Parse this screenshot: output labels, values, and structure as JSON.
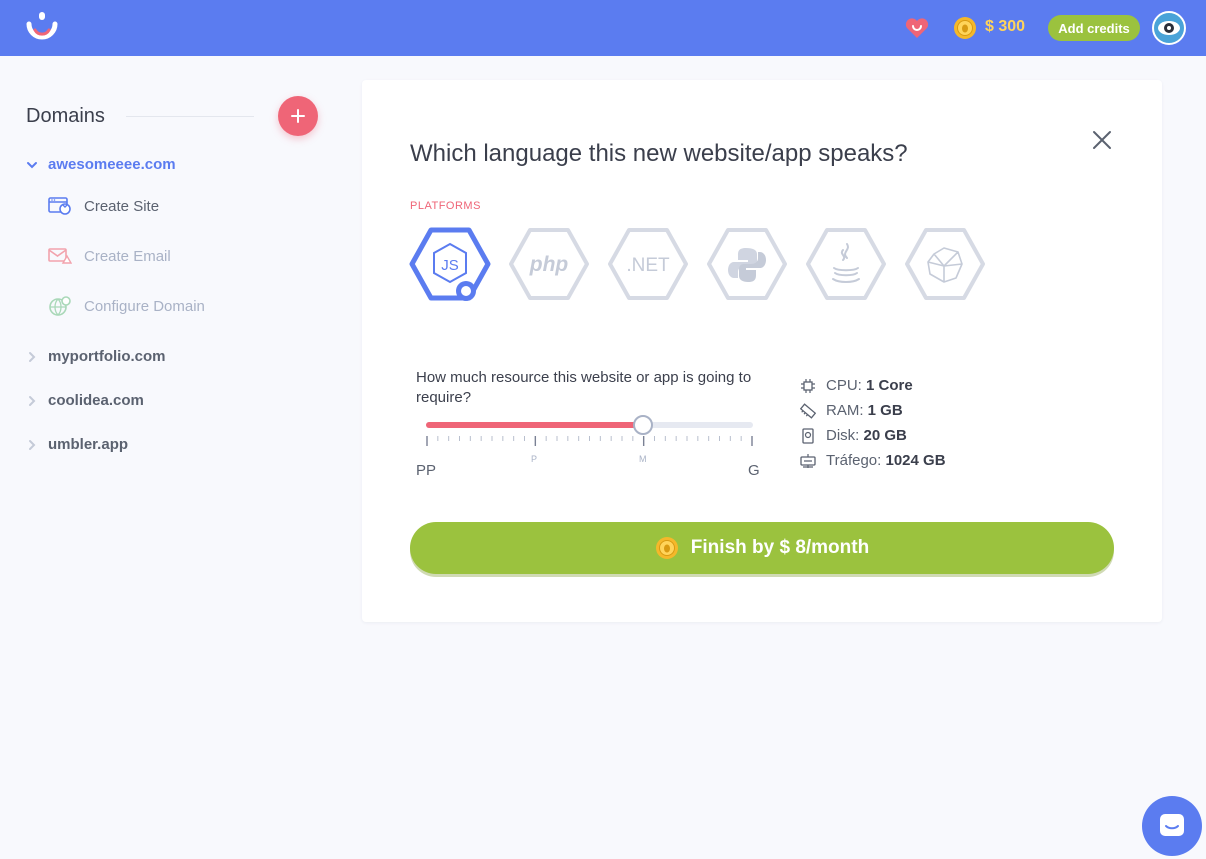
{
  "header": {
    "credits_amount": "$ 300",
    "add_credits_label": "Add credits"
  },
  "sidebar": {
    "title": "Domains",
    "domains": [
      {
        "label": "awesomeeee.com",
        "expanded": true
      },
      {
        "label": "myportfolio.com",
        "expanded": false
      },
      {
        "label": "coolidea.com",
        "expanded": false
      },
      {
        "label": "umbler.app",
        "expanded": false
      }
    ],
    "sub_items": [
      {
        "label": "Create Site",
        "icon": "browser-icon",
        "enabled": true
      },
      {
        "label": "Create Email",
        "icon": "envelope-icon",
        "enabled": false
      },
      {
        "label": "Configure Domain",
        "icon": "globe-icon",
        "enabled": false
      }
    ]
  },
  "modal": {
    "title": "Which language this new website/app speaks?",
    "platforms_label": "PLATFORMS",
    "platforms": [
      {
        "name": "nodejs",
        "icon": "nodejs-icon",
        "selected": true
      },
      {
        "name": "php",
        "label": "php",
        "icon": "php-icon",
        "selected": false
      },
      {
        "name": "dotnet",
        "label": ".NET",
        "icon": "dotnet-icon",
        "selected": false
      },
      {
        "name": "python",
        "icon": "python-icon",
        "selected": false
      },
      {
        "name": "java",
        "icon": "java-icon",
        "selected": false
      },
      {
        "name": "ruby",
        "icon": "ruby-icon",
        "selected": false
      }
    ],
    "resource": {
      "question": "How much resource this website or app is going to require?",
      "level_fraction": 0.665,
      "scale_labels": {
        "start": "PP",
        "small": "P",
        "medium": "M",
        "end": "G"
      }
    },
    "specs": [
      {
        "label": "CPU:",
        "value": "1 Core",
        "icon": "cpu-icon"
      },
      {
        "label": "RAM:",
        "value": "1 GB",
        "icon": "ram-icon"
      },
      {
        "label": "Disk:",
        "value": "20 GB",
        "icon": "disk-icon"
      },
      {
        "label": "Tráfego:",
        "value": "1024 GB",
        "icon": "traffic-icon"
      }
    ],
    "finish_label": "Finish by $ 8/month"
  },
  "colors": {
    "brand_blue": "#5b7cf0",
    "accent_red": "#ef6577",
    "accent_green": "#9bc23e"
  }
}
